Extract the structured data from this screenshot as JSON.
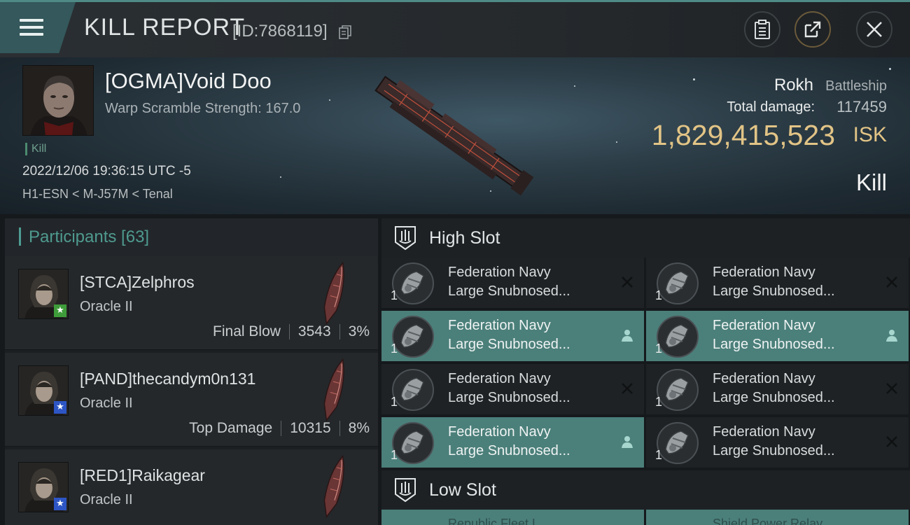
{
  "header": {
    "title": "KILL REPORT",
    "report_id": "[ID:7868119]"
  },
  "victim": {
    "name": "[OGMA]Void Doo",
    "warp_scramble": "Warp Scramble Strength: 167.0",
    "kill_tag": "Kill",
    "datetime": "2022/12/06 19:36:15 UTC -5",
    "location": "H1-ESN < M-J57M < Tenal",
    "ship_name": "Rokh",
    "ship_class": "Battleship",
    "total_damage_label": "Total damage:",
    "total_damage": "117459",
    "isk_value": "1,829,415,523",
    "isk_unit": "ISK",
    "result": "Kill"
  },
  "participants": {
    "header": "Participants [63]",
    "items": [
      {
        "name": "[STCA]Zelphros",
        "ship": "Oracle II",
        "label": "Final Blow",
        "damage": "3543",
        "percent": "3%",
        "badge_color": "#3f9c3a",
        "badge": "★"
      },
      {
        "name": "[PAND]thecandym0n131",
        "ship": "Oracle II",
        "label": "Top Damage",
        "damage": "10315",
        "percent": "8%",
        "badge_color": "#2d55c4",
        "badge": "★"
      },
      {
        "name": "[RED1]Raikagear",
        "ship": "Oracle II",
        "label": "",
        "damage": "",
        "percent": "",
        "badge_color": "#2d55c4",
        "badge": "★"
      }
    ]
  },
  "fitting": {
    "high_slot_title": "High Slot",
    "low_slot_title": "Low Slot",
    "high_modules": [
      {
        "line1": "Federation Navy",
        "line2": "Large Snubnosed...",
        "qty": "1",
        "status": "destroyed"
      },
      {
        "line1": "Federation Navy",
        "line2": "Large Snubnosed...",
        "qty": "1",
        "status": "destroyed"
      },
      {
        "line1": "Federation Navy",
        "line2": "Large Snubnosed...",
        "qty": "1",
        "status": "dropped"
      },
      {
        "line1": "Federation Navy",
        "line2": "Large Snubnosed...",
        "qty": "1",
        "status": "dropped"
      },
      {
        "line1": "Federation Navy",
        "line2": "Large Snubnosed...",
        "qty": "1",
        "status": "destroyed"
      },
      {
        "line1": "Federation Navy",
        "line2": "Large Snubnosed...",
        "qty": "1",
        "status": "destroyed"
      },
      {
        "line1": "Federation Navy",
        "line2": "Large Snubnosed...",
        "qty": "1",
        "status": "dropped"
      },
      {
        "line1": "Federation Navy",
        "line2": "Large Snubnosed...",
        "qty": "1",
        "status": "destroyed"
      }
    ],
    "low_modules": [
      {
        "text": "Republic Fleet L..."
      },
      {
        "text": "Shield Power Relay..."
      }
    ]
  },
  "colors": {
    "accent_teal": "#4e9c93",
    "isk_gold": "#e2c486",
    "dropped_bg": "#4b7f7a",
    "panel_bg": "#1e2225"
  },
  "icons": {
    "menu": "hamburger-icon",
    "copy": "copy-icon",
    "clipboard": "clipboard-icon",
    "share": "share-icon",
    "close": "close-icon",
    "slot": "turret-slot-icon",
    "destroyed": "x-mark-icon",
    "dropped": "person-icon"
  }
}
